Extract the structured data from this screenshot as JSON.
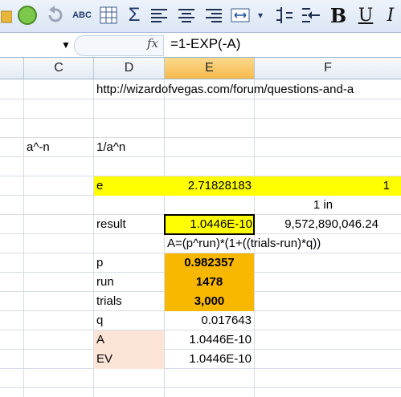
{
  "toolbar": {
    "buttons": [
      {
        "name": "folder-icon"
      },
      {
        "name": "green-circle-icon"
      },
      {
        "name": "undo-icon"
      },
      {
        "name": "spellcheck-icon",
        "label": "ABC"
      },
      {
        "name": "table-icon"
      },
      {
        "name": "sigma-icon",
        "label": "Σ"
      },
      {
        "name": "align-left-icon"
      },
      {
        "name": "align-center-icon"
      },
      {
        "name": "align-right-icon"
      },
      {
        "name": "merge-cells-icon"
      },
      {
        "name": "format-dropdown-icon"
      },
      {
        "name": "indent-icon"
      },
      {
        "name": "outdent-icon"
      },
      {
        "name": "bold-icon",
        "label": "B"
      },
      {
        "name": "underline-icon",
        "label": "U"
      },
      {
        "name": "italic-icon",
        "label": "I"
      }
    ]
  },
  "formula_bar": {
    "fx_label": "fx",
    "formula": "=1-EXP(-A)"
  },
  "columns": [
    "C",
    "D",
    "E",
    "F"
  ],
  "cells": {
    "url": "http://wizardofvegas.com/forum/questions-and-a",
    "a_n": "a^-n",
    "inv_a_n": "1/a^n",
    "e_label": "e",
    "e_value": "2.71828183",
    "e_right": "1",
    "one_in": "1 in",
    "result_label": "result",
    "result_value": "1.0446E-10",
    "result_f": "9,572,890,046.24",
    "formula_note": "A=(p^run)*(1+((trials-run)*q))",
    "p_label": "p",
    "p_value": "0.982357",
    "run_label": "run",
    "run_value": "1478",
    "trials_label": "trials",
    "trials_value": "3,000",
    "q_label": "q",
    "q_value": "0.017643",
    "a_label": "A",
    "a_value": "1.0446E-10",
    "ev_label": "EV",
    "ev_value": "1.0446E-10"
  }
}
